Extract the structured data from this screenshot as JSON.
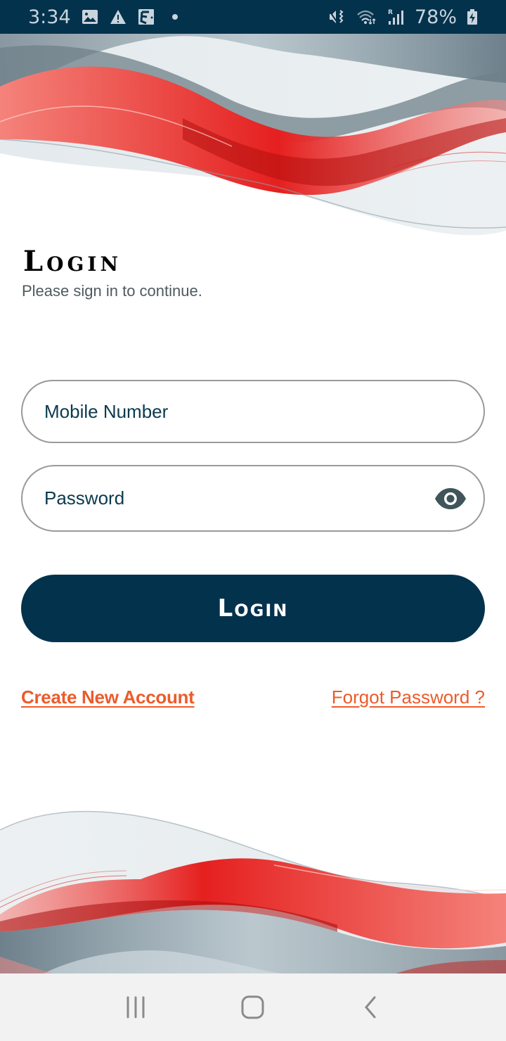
{
  "status_bar": {
    "time": "3:34",
    "left_icons": [
      "gallery-icon",
      "warning-icon",
      "edit-app-icon",
      "notification-dot"
    ],
    "right_icons": [
      "mute-vibrate-icon",
      "wifi-icon",
      "signal-roaming-icon"
    ],
    "battery_percent": "78%",
    "battery_state": "charging"
  },
  "login": {
    "title": "Login",
    "subtitle": "Please sign in to continue.",
    "mobile_placeholder": "Mobile Number",
    "mobile_value": "",
    "password_placeholder": "Password",
    "password_value": "",
    "password_toggle_icon": "eye-icon",
    "submit_label": "Login",
    "create_account_label": "Create New Account",
    "forgot_password_label": "Forgot Password ?"
  },
  "nav_bar": {
    "buttons": [
      "recent-apps-icon",
      "home-icon",
      "back-icon"
    ]
  },
  "colors": {
    "primary": "#03324d",
    "link": "#ec5b2a",
    "wave_red": "#e8282a",
    "wave_gray": "#8fa3ad"
  }
}
